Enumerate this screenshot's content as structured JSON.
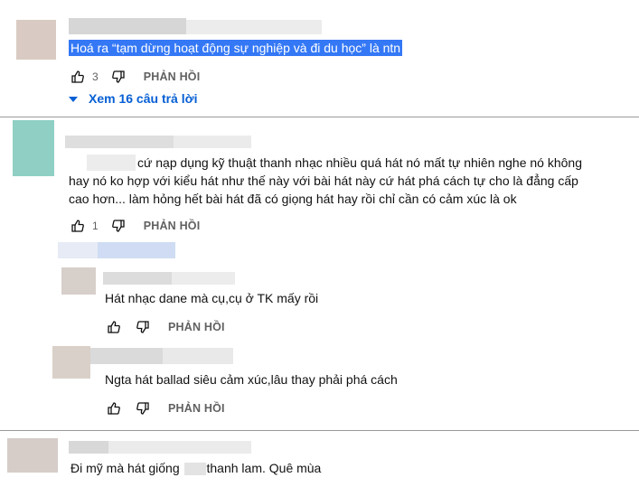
{
  "comments": [
    {
      "text": "Hoá ra “tạm dừng hoạt động sự nghiệp và đi du học” là ntn",
      "like_count": "3",
      "reply_label": "PHẢN HỒI",
      "view_replies": "Xem 16 câu trả lời"
    },
    {
      "line1": "cứ nạp dụng kỹ thuật thanh nhạc nhiều quá hát nó mất tự nhiên nghe nó không",
      "line2": "hay nó ko  hợp với kiểu hát như thế này với bài hát này cứ hát phá cách  tự cho  là đẳng cấp",
      "line3": "cao hơn... làm hỏng hết bài  hát  đã có giọng hát hay rồi chỉ cần có cảm xúc là ok",
      "like_count": "1",
      "reply_label": "PHẢN HỒI"
    },
    {
      "text": "Hát nhạc dane mà cụ,cụ ở TK mấy rồi",
      "reply_label": "PHẢN HỒI"
    },
    {
      "text": "Ngta hát ballad siêu cảm xúc,lâu thay phải phá cách",
      "reply_label": "PHẢN HỒI"
    },
    {
      "text_part1": "Đi mỹ mà hát giống",
      "text_part2": "thanh lam. Quê mùa"
    }
  ],
  "colors": {
    "highlight": "#3478f6",
    "link": "#065fd4",
    "muted": "#606060"
  },
  "icons": [
    "thumbs-up-icon",
    "thumbs-down-icon",
    "triangle-down-icon"
  ]
}
